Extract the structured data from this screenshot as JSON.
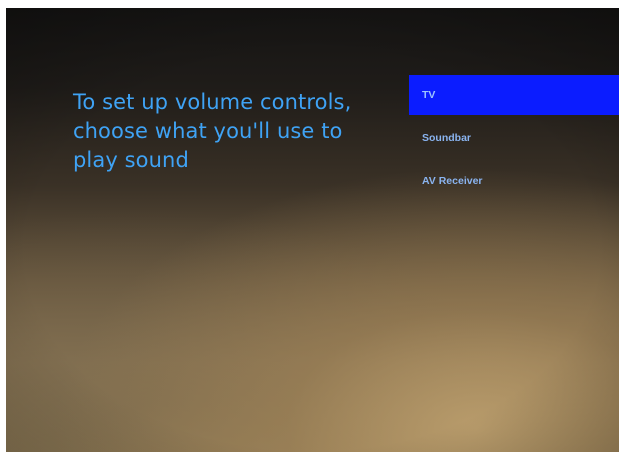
{
  "screen": {
    "prompt": "To set up volume controls, choose what you'll use to play sound"
  },
  "options": [
    {
      "label": "TV",
      "selected": true
    },
    {
      "label": "Soundbar",
      "selected": false
    },
    {
      "label": "AV Receiver",
      "selected": false
    }
  ],
  "colors": {
    "prompt_text": "#3fa3f5",
    "selection_highlight": "#0b1cff",
    "option_text": "#8ab4f0"
  }
}
